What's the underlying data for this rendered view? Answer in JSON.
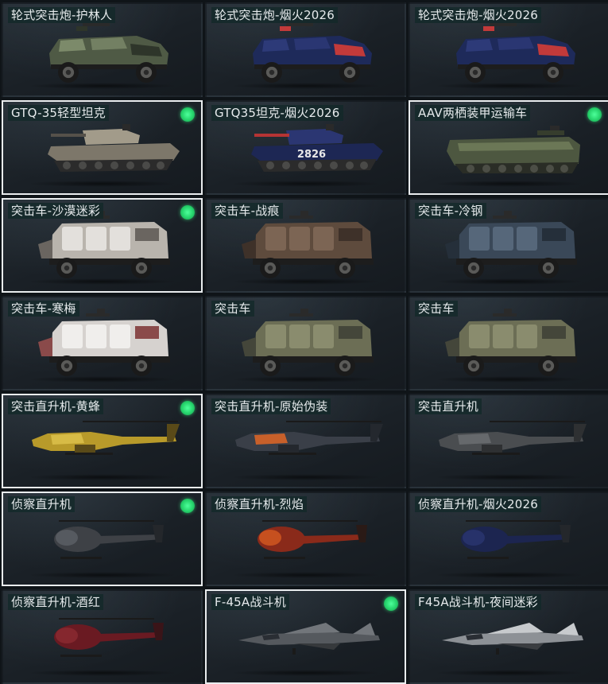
{
  "colors": {
    "selected_border": "#e9ecee",
    "equipped_dot": "#25d36b",
    "label_bg": "#122828"
  },
  "vehicles": [
    {
      "name": "轮式突击炮-护林人",
      "type": "armored-car-gun",
      "camo": [
        "#4f5a45",
        "#7c8a6a",
        "#2e352a"
      ],
      "selected": false,
      "equipped": false,
      "icon": "armored-car-icon"
    },
    {
      "name": "轮式突击炮-烟火2026",
      "type": "armored-car-gun",
      "camo": [
        "#1e2a5a",
        "#2d3a78",
        "#c23a3a"
      ],
      "selected": false,
      "equipped": false,
      "icon": "armored-car-icon"
    },
    {
      "name": "轮式突击炮-烟火2026",
      "type": "armored-car-gun",
      "camo": [
        "#1e2a5a",
        "#2d3a78",
        "#c23a3a"
      ],
      "selected": false,
      "equipped": false,
      "icon": "armored-car-icon"
    },
    {
      "name": "GTQ-35轻型坦克",
      "type": "tank",
      "camo": [
        "#7d776a",
        "#a29b8a",
        "#55514a"
      ],
      "selected": true,
      "equipped": true,
      "icon": "tank-icon"
    },
    {
      "name": "GTQ35坦克-烟火2026",
      "type": "tank",
      "camo": [
        "#1d2754",
        "#2b3672",
        "#b53434"
      ],
      "selected": false,
      "equipped": false,
      "icon": "tank-icon",
      "decal": "2826"
    },
    {
      "name": "AAV两栖装甲运输车",
      "type": "amphibious",
      "camo": [
        "#4d5740",
        "#6b7756",
        "#363d2d"
      ],
      "selected": true,
      "equipped": true,
      "icon": "amphibious-vehicle-icon"
    },
    {
      "name": "突击车-沙漠迷彩",
      "type": "mrap",
      "camo": [
        "#b9b4ad",
        "#e3e0dc",
        "#6a6560"
      ],
      "selected": true,
      "equipped": true,
      "icon": "assault-vehicle-icon"
    },
    {
      "name": "突击车-战痕",
      "type": "mrap",
      "camo": [
        "#5e4b3d",
        "#7c6554",
        "#3e3129"
      ],
      "selected": false,
      "equipped": false,
      "icon": "assault-vehicle-icon"
    },
    {
      "name": "突击车-冷钢",
      "type": "mrap",
      "camo": [
        "#3a4858",
        "#56677a",
        "#252f3a"
      ],
      "selected": false,
      "equipped": false,
      "icon": "assault-vehicle-icon"
    },
    {
      "name": "突击车-寒梅",
      "type": "mrap",
      "camo": [
        "#d6d2cf",
        "#f0eeec",
        "#8a4a4a"
      ],
      "selected": false,
      "equipped": false,
      "icon": "assault-vehicle-icon"
    },
    {
      "name": "突击车",
      "type": "mrap",
      "camo": [
        "#6c6e55",
        "#8a8c6e",
        "#44463a"
      ],
      "selected": false,
      "equipped": false,
      "icon": "assault-vehicle-icon"
    },
    {
      "name": "突击车",
      "type": "mrap",
      "camo": [
        "#6c6e55",
        "#8a8c6e",
        "#44463a"
      ],
      "selected": false,
      "equipped": false,
      "icon": "assault-vehicle-icon"
    },
    {
      "name": "突击直升机-黄蜂",
      "type": "attack-heli",
      "camo": [
        "#b89a2a",
        "#d7bb46",
        "#5a4a18"
      ],
      "selected": true,
      "equipped": true,
      "icon": "attack-helicopter-icon"
    },
    {
      "name": "突击直升机-原始伪装",
      "type": "attack-heli",
      "camo": [
        "#3a3f48",
        "#c8602a",
        "#24282e"
      ],
      "selected": false,
      "equipped": false,
      "icon": "attack-helicopter-icon"
    },
    {
      "name": "突击直升机",
      "type": "attack-heli",
      "camo": [
        "#4a4d50",
        "#66696c",
        "#2e3032"
      ],
      "selected": false,
      "equipped": false,
      "icon": "attack-helicopter-icon"
    },
    {
      "name": "侦察直升机",
      "type": "scout-heli",
      "camo": [
        "#3e4146",
        "#5c6066",
        "#24272b"
      ],
      "selected": true,
      "equipped": true,
      "icon": "scout-helicopter-icon"
    },
    {
      "name": "侦察直升机-烈焰",
      "type": "scout-heli",
      "camo": [
        "#8a2a1a",
        "#d45a20",
        "#2a1a16"
      ],
      "selected": false,
      "equipped": false,
      "icon": "scout-helicopter-icon"
    },
    {
      "name": "侦察直升机-烟火2026",
      "type": "scout-heli",
      "camo": [
        "#1c2550",
        "#2a3670",
        "#24272b"
      ],
      "selected": false,
      "equipped": false,
      "icon": "scout-helicopter-icon"
    },
    {
      "name": "侦察直升机-酒红",
      "type": "scout-heli",
      "camo": [
        "#6a1a22",
        "#8c2a32",
        "#3a1418"
      ],
      "selected": false,
      "equipped": false,
      "icon": "scout-helicopter-icon"
    },
    {
      "name": "F-45A战斗机",
      "type": "jet",
      "camo": [
        "#55595e",
        "#72767b",
        "#36393c"
      ],
      "selected": true,
      "equipped": true,
      "icon": "fighter-jet-icon"
    },
    {
      "name": "F45A战斗机-夜间迷彩",
      "type": "jet",
      "camo": [
        "#8d9196",
        "#c7cacd",
        "#3a3d41"
      ],
      "selected": false,
      "equipped": false,
      "icon": "fighter-jet-icon"
    }
  ]
}
